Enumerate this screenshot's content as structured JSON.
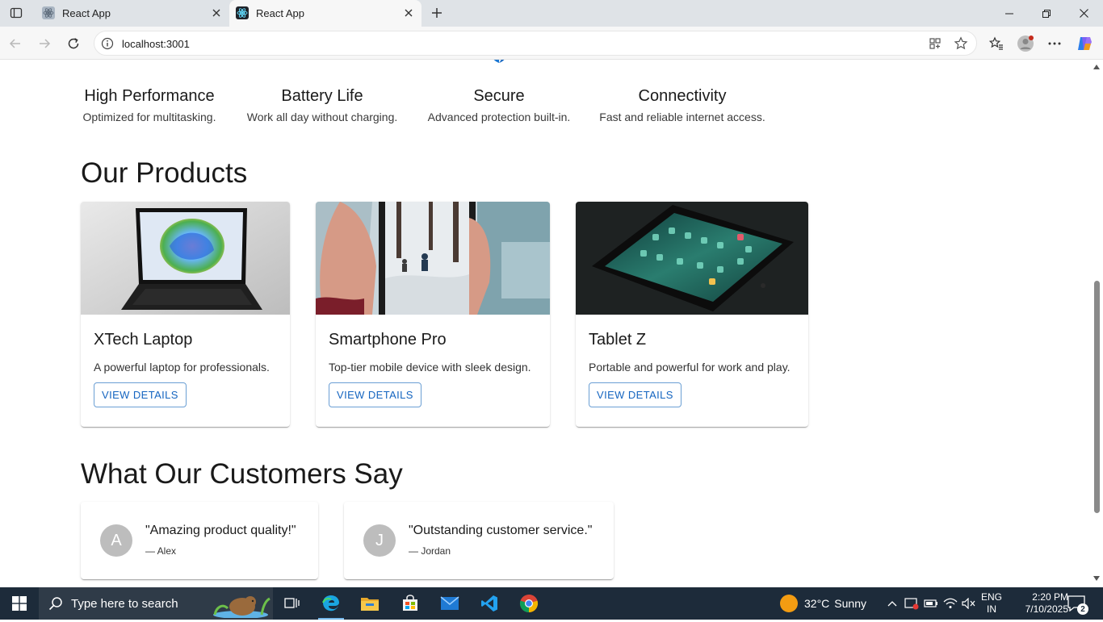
{
  "browser": {
    "tabs": [
      {
        "title": "React App"
      },
      {
        "title": "React App"
      }
    ],
    "url": "localhost:3001"
  },
  "features": [
    {
      "title": "High Performance",
      "description": "Optimized for multitasking."
    },
    {
      "title": "Battery Life",
      "description": "Work all day without charging."
    },
    {
      "title": "Secure",
      "description": "Advanced protection built-in."
    },
    {
      "title": "Connectivity",
      "description": "Fast and reliable internet access."
    }
  ],
  "products_section": {
    "title": "Our Products",
    "items": [
      {
        "name": "XTech Laptop",
        "description": "A powerful laptop for professionals.",
        "button": "VIEW DETAILS"
      },
      {
        "name": "Smartphone Pro",
        "description": "Top-tier mobile device with sleek design.",
        "button": "VIEW DETAILS"
      },
      {
        "name": "Tablet Z",
        "description": "Portable and powerful for work and play.",
        "button": "VIEW DETAILS"
      }
    ]
  },
  "testimonials_section": {
    "title": "What Our Customers Say",
    "items": [
      {
        "initial": "A",
        "quote": "\"Amazing product quality!\"",
        "author": "— Alex"
      },
      {
        "initial": "J",
        "quote": "\"Outstanding customer service.\"",
        "author": "— Jordan"
      }
    ]
  },
  "taskbar": {
    "search_placeholder": "Type here to search",
    "weather": {
      "temp": "32°C",
      "condition": "Sunny"
    },
    "language": {
      "line1": "ENG",
      "line2": "IN"
    },
    "clock": {
      "time": "2:20 PM",
      "date": "7/10/2025"
    },
    "notification_count": "2"
  },
  "colors": {
    "accent": "#1565c0",
    "taskbar": "#1d2b3a",
    "avatar": "#bdbdbd"
  }
}
